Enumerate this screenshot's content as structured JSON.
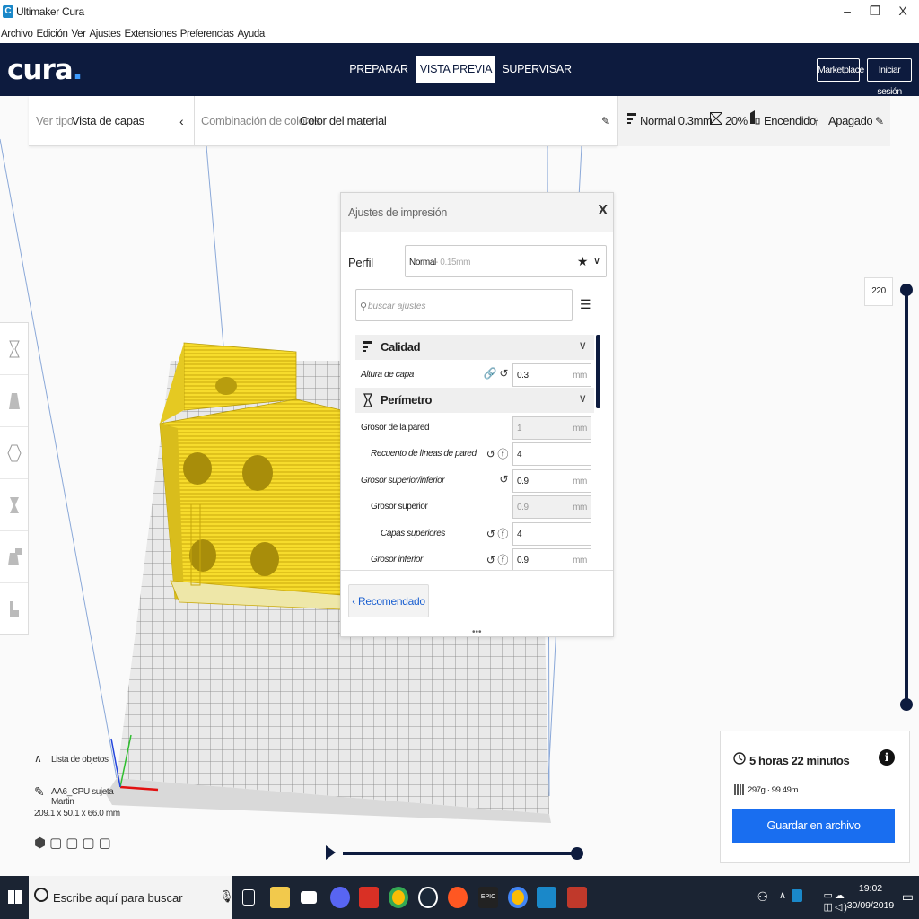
{
  "window": {
    "title": "Ultimaker Cura",
    "app_icon": "C",
    "minimize": "–",
    "maximize": "❐",
    "close": "X"
  },
  "menu": [
    "Archivo",
    "Edición",
    "Ver",
    "Ajustes",
    "Extensiones",
    "Preferencias",
    "Ayuda"
  ],
  "header": {
    "logo": "cura",
    "logo_dot": ".",
    "tabs": [
      {
        "label": "PREPARAR"
      },
      {
        "label": "VISTA PREVIA"
      },
      {
        "label": "SUPERVISAR"
      }
    ],
    "marketplace": "Marketplace",
    "login": "Iniciar sesión"
  },
  "viewbar": {
    "view_type_label": "Ver tipo",
    "view_type_value": "Vista de capas",
    "color_scheme_label": "Combinación de colores",
    "color_scheme_value": "Color del material"
  },
  "settingsbar": {
    "profile": "Normal 0.3mm",
    "infill": "20%",
    "support": "Encendido",
    "adhesion": "Apagado"
  },
  "panel": {
    "title": "Ajustes de impresión",
    "close": "X",
    "profile_label": "Perfil",
    "profile_name": "Normal",
    "profile_detail": "- 0.15mm",
    "search_placeholder": "buscar ajustes",
    "categories": {
      "quality": "Calidad",
      "shell": "Perímetro"
    },
    "rows": {
      "layer_height": {
        "label": "Altura de capa",
        "value": "0.3",
        "unit": "mm"
      },
      "wall_thickness": {
        "label": "Grosor de la pared",
        "value": "1",
        "unit": "mm"
      },
      "wall_line_count": {
        "label": "Recuento de líneas de pared",
        "value": "4"
      },
      "top_bottom": {
        "label": "Grosor superior/inferior",
        "value": "0.9",
        "unit": "mm"
      },
      "top_thickness": {
        "label": "Grosor superior",
        "value": "0.9",
        "unit": "mm"
      },
      "top_layers": {
        "label": "Capas superiores",
        "value": "4"
      },
      "bottom_thickness": {
        "label": "Grosor inferior",
        "value": "0.9",
        "unit": "mm"
      }
    },
    "recommended": "Recomendado",
    "grip": "•••"
  },
  "layer_slider": {
    "value": "220"
  },
  "objects": {
    "list_label": "Lista de objetos",
    "object_name": "AA6_CPU sujeta Martin",
    "dimensions": "209.1 x 50.1 x 66.0 mm"
  },
  "estimate": {
    "time": "5 horas 22 minutos",
    "material": "297g · 99.49m",
    "save": "Guardar en archivo",
    "info": "i"
  },
  "taskbar": {
    "search": "Escribe aquí para buscar",
    "time": "19:02",
    "date": "30/09/2019",
    "epic": "EPIC"
  },
  "colors": {
    "header": "#0d1b3e",
    "accent": "#196ef0",
    "model": "#f7dc2c"
  }
}
